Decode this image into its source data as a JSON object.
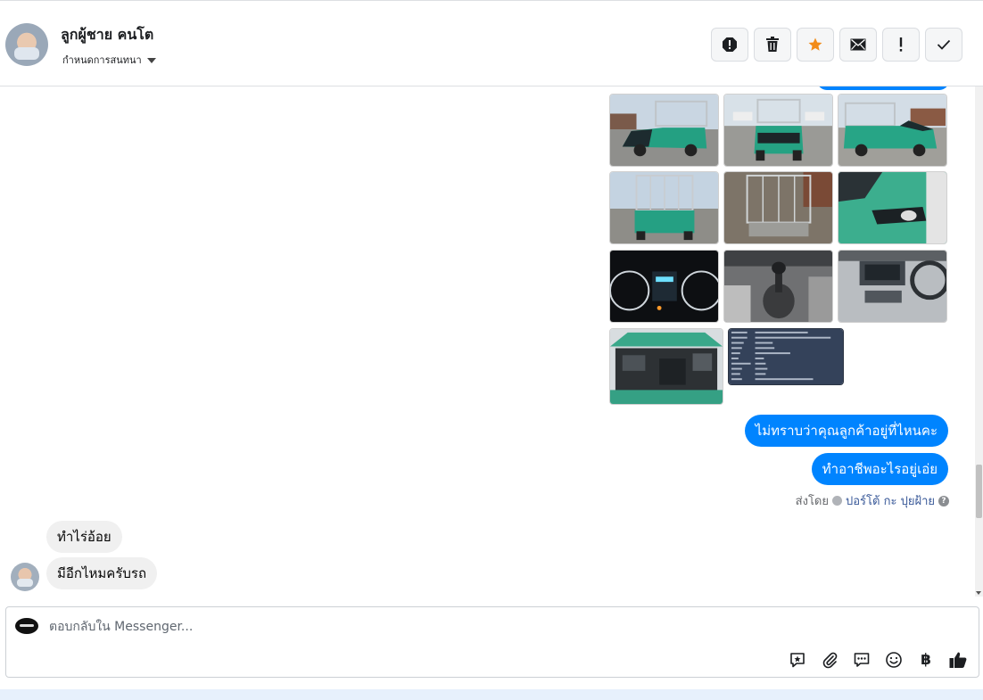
{
  "header": {
    "contact_name": "ลูกผู้ชาย คนโต",
    "label_dropdown": "กำหนดการสนทนา",
    "actions": [
      {
        "name": "spam-button",
        "icon": "alert-octagon-icon"
      },
      {
        "name": "delete-button",
        "icon": "trash-icon"
      },
      {
        "name": "star-button",
        "icon": "star-icon",
        "color": "#f28c1a"
      },
      {
        "name": "mark-unread-button",
        "icon": "envelope-icon"
      },
      {
        "name": "follow-up-button",
        "icon": "exclamation-icon"
      },
      {
        "name": "mark-done-button",
        "icon": "check-icon"
      }
    ]
  },
  "conversation": {
    "photos": [
      {
        "alt": "green pickup truck front-left"
      },
      {
        "alt": "green pickup truck front"
      },
      {
        "alt": "green pickup truck side"
      },
      {
        "alt": "pickup truck rear with cage"
      },
      {
        "alt": "pickup bed with cage"
      },
      {
        "alt": "fog lamp close-up"
      },
      {
        "alt": "instrument cluster"
      },
      {
        "alt": "gear shifter"
      },
      {
        "alt": "dashboard console"
      },
      {
        "alt": "engine bay"
      },
      {
        "alt": "specification text screenshot"
      }
    ],
    "outgoing_messages": [
      "ไม่ทราบว่าคุณลูกค้าอยู่ที่ไหนคะ",
      "ทำอาชีพอะไรอยู่เอ่ย"
    ],
    "sent_by": {
      "prefix": "ส่งโดย",
      "name": "ปอร์โต้ กะ ปุยฝ้าย",
      "help": "?"
    },
    "incoming_messages": [
      "ทำไร่อ้อย",
      "มีอีกไหมครับรถ"
    ]
  },
  "composer": {
    "placeholder": "ตอบกลับใน Messenger...",
    "tools": [
      {
        "name": "saved-reply-icon"
      },
      {
        "name": "attach-icon"
      },
      {
        "name": "quick-replies-icon"
      },
      {
        "name": "emoji-icon"
      },
      {
        "name": "baht-icon",
        "glyph": "฿"
      },
      {
        "name": "like-icon"
      }
    ]
  },
  "colors": {
    "outgoing_bubble": "#0084ff",
    "incoming_bubble": "#f0f0f0",
    "star": "#f28c1a",
    "link": "#385898"
  }
}
